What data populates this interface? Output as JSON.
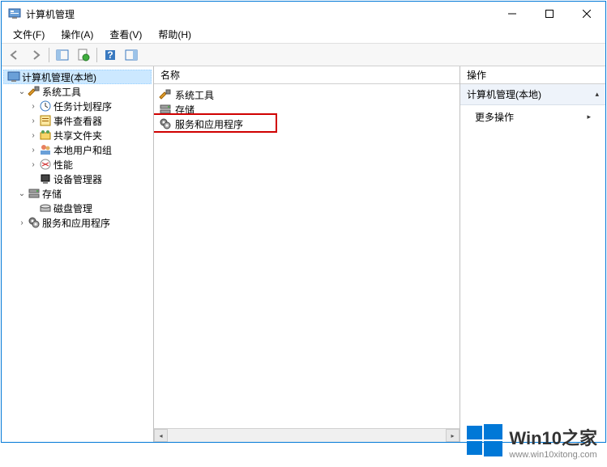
{
  "window": {
    "title": "计算机管理"
  },
  "menubar": {
    "file": "文件(F)",
    "action": "操作(A)",
    "view": "查看(V)",
    "help": "帮助(H)"
  },
  "tree": {
    "root": "计算机管理(本地)",
    "sys": "系统工具",
    "sched": "任务计划程序",
    "event": "事件查看器",
    "share": "共享文件夹",
    "users": "本地用户和组",
    "perf": "性能",
    "devmgr": "设备管理器",
    "storage": "存储",
    "disk": "磁盘管理",
    "svc": "服务和应用程序"
  },
  "mid": {
    "col_name": "名称",
    "items": {
      "sys": "系统工具",
      "storage": "存储",
      "svc": "服务和应用程序"
    }
  },
  "actions": {
    "header": "操作",
    "group": "计算机管理(本地)",
    "more": "更多操作"
  },
  "watermark": {
    "title": "Win10之家",
    "domain": "www.win10xitong.com"
  }
}
